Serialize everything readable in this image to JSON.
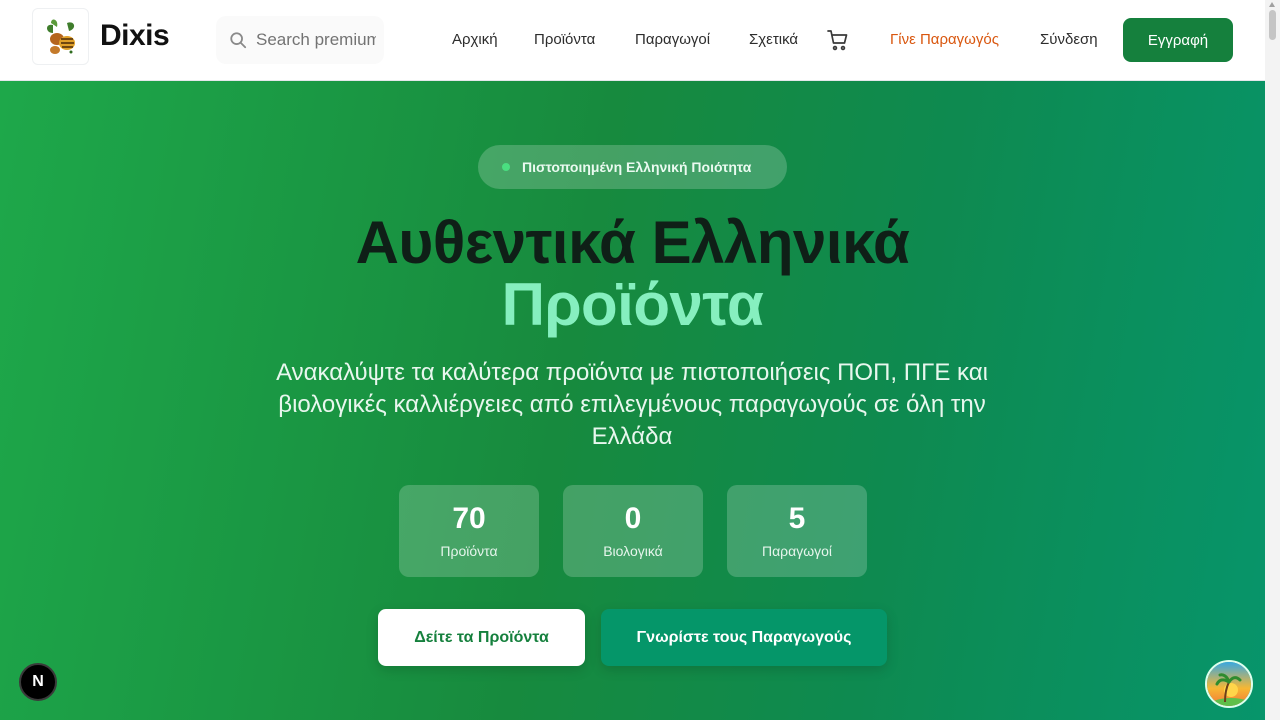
{
  "header": {
    "brand": "Dixis",
    "search_placeholder": "Search premium products...",
    "nav": [
      "Αρχική",
      "Προϊόντα",
      "Παραγωγοί",
      "Σχετικά"
    ],
    "become_producer": "Γίνε Παραγωγός",
    "login": "Σύνδεση",
    "signup": "Εγγραφή"
  },
  "hero": {
    "badge": "Πιστοποιημένη Ελληνική Ποιότητα",
    "title_line1": "Αυθεντικά Ελληνικά",
    "title_line2": "Προϊόντα",
    "subtitle": "Ανακαλύψτε τα καλύτερα προϊόντα με πιστοποιήσεις ΠΟΠ, ΠΓΕ και βιολογικές καλλιέργειες από επιλεγμένους παραγωγούς σε όλη την Ελλάδα",
    "stats": [
      {
        "value": "70",
        "label": "Προϊόντα"
      },
      {
        "value": "0",
        "label": "Βιολογικά"
      },
      {
        "value": "5",
        "label": "Παραγωγοί"
      }
    ],
    "cta_primary": "Δείτε τα Προϊόντα",
    "cta_secondary": "Γνωρίστε τους Παραγωγούς"
  },
  "dev_badge": "N",
  "colors": {
    "brand_green": "#15803d",
    "accent_orange": "#d9570f",
    "highlight_mint": "#86efbf"
  },
  "icons": [
    "logo-icon",
    "search-icon",
    "cart-icon",
    "next-dev-icon",
    "chat-avatar-icon"
  ]
}
